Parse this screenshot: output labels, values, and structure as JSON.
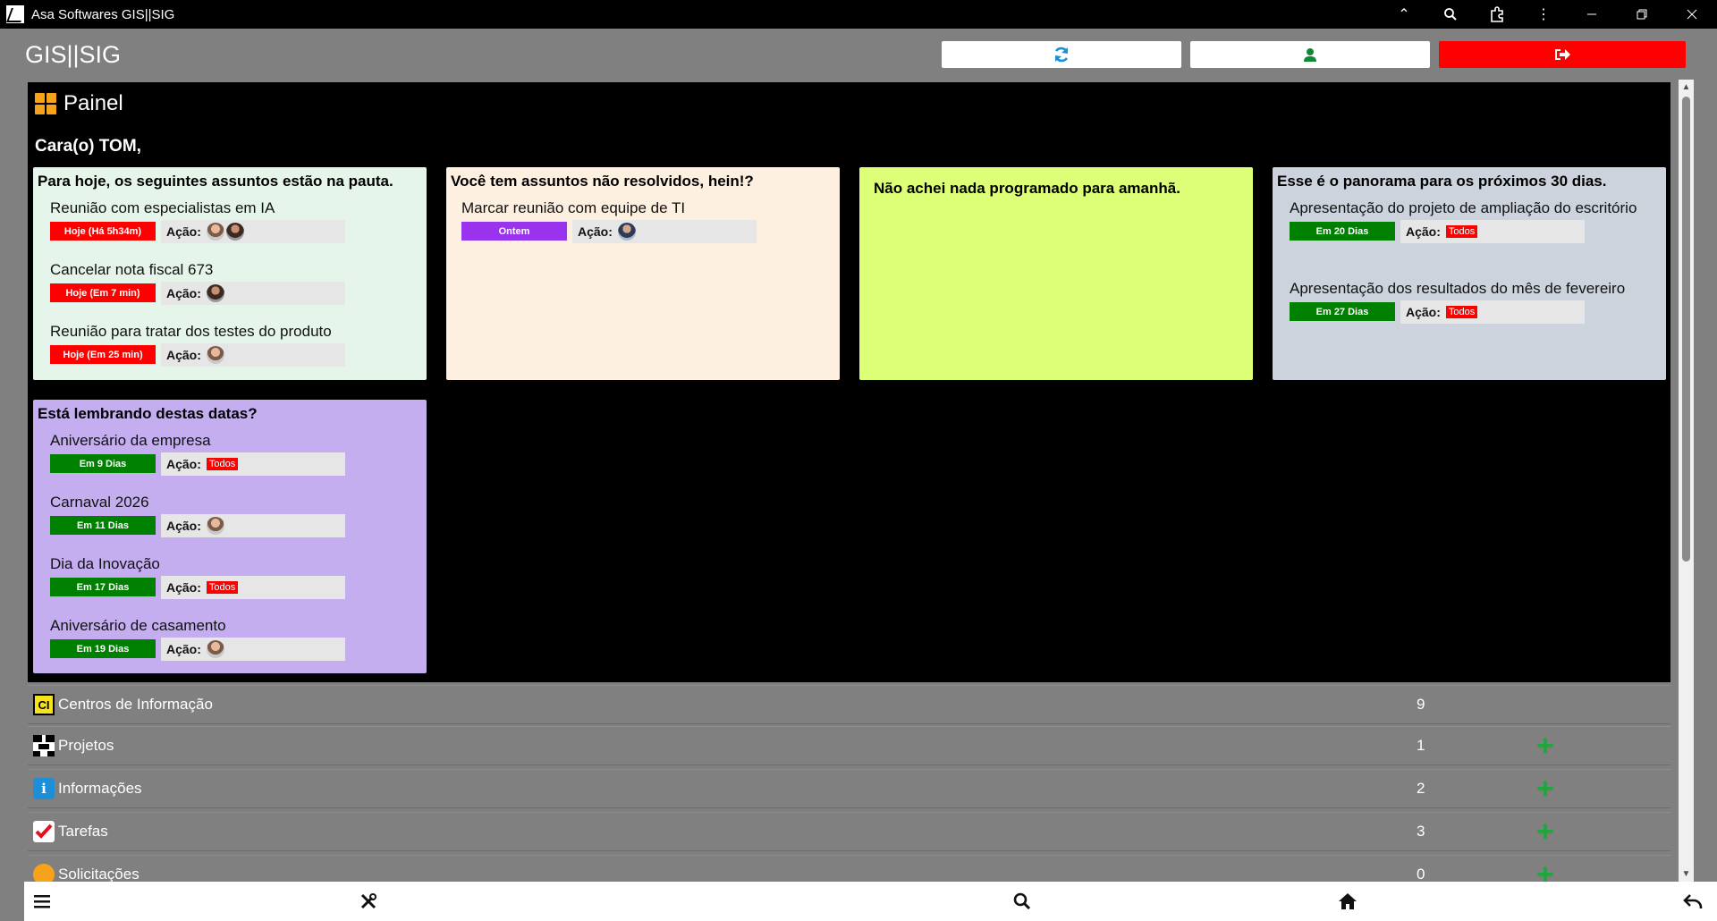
{
  "window": {
    "title": "Asa Softwares GIS||SIG"
  },
  "app": {
    "brand": "GIS||SIG"
  },
  "painel": {
    "title": "Painel",
    "greeting": "Cara(o) TOM,",
    "action_label": "Ação:",
    "cards": {
      "today": {
        "title": "Para hoje, os seguintes assuntos estão na pauta.",
        "items": [
          {
            "title": "Reunião com especialistas em IA",
            "badge": "Hoje (Há 5h34m)"
          },
          {
            "title": "Cancelar nota fiscal 673",
            "badge": "Hoje (Em 7 min)"
          },
          {
            "title": "Reunião para tratar dos testes do produto",
            "badge": "Hoje (Em 25 min)"
          }
        ]
      },
      "unresolved": {
        "title": "Você tem assuntos não resolvidos, hein!?",
        "items": [
          {
            "title": "Marcar reunião com equipe de TI",
            "badge": "Ontem"
          }
        ]
      },
      "tomorrow": {
        "title": "Não achei nada programado para amanhã."
      },
      "next30": {
        "title": "Esse é o panorama para os próximos 30 dias.",
        "items": [
          {
            "title": "Apresentação do projeto de ampliação do escritório",
            "badge": "Em 20 Dias",
            "tag": "Todos"
          },
          {
            "title": "Apresentação dos resultados do mês de fevereiro",
            "badge": "Em 27 Dias",
            "tag": "Todos"
          }
        ]
      },
      "dates": {
        "title": "Está lembrando destas datas?",
        "items": [
          {
            "title": "Aniversário da empresa",
            "badge": "Em 9 Dias",
            "tag": "Todos"
          },
          {
            "title": "Carnaval 2026",
            "badge": "Em 11 Dias"
          },
          {
            "title": "Dia da Inovação",
            "badge": "Em 17 Dias",
            "tag": "Todos"
          },
          {
            "title": "Aniversário de casamento",
            "badge": "Em 19 Dias"
          }
        ]
      }
    }
  },
  "sections": [
    {
      "label": "Centros de Informação",
      "count": "9",
      "icon_text": "CI"
    },
    {
      "label": "Projetos",
      "count": "1"
    },
    {
      "label": "Informações",
      "count": "2",
      "icon_text": "i"
    },
    {
      "label": "Tarefas",
      "count": "3"
    },
    {
      "label": "Solicitações",
      "count": "0"
    }
  ],
  "colors": {
    "card_today": "#e6f5ea",
    "card_unresolved": "#fdf0e0",
    "card_tomorrow": "#ddff77",
    "card_next30": "#cdd3dc",
    "card_dates": "#c4aef0",
    "badge_red": "#ff0000",
    "badge_green": "#008000",
    "badge_purple": "#9933ee",
    "logout": "#ff0000",
    "refresh_icon": "#1e8fd6",
    "user_icon": "#118833",
    "add_icon": "#1fa83a"
  }
}
